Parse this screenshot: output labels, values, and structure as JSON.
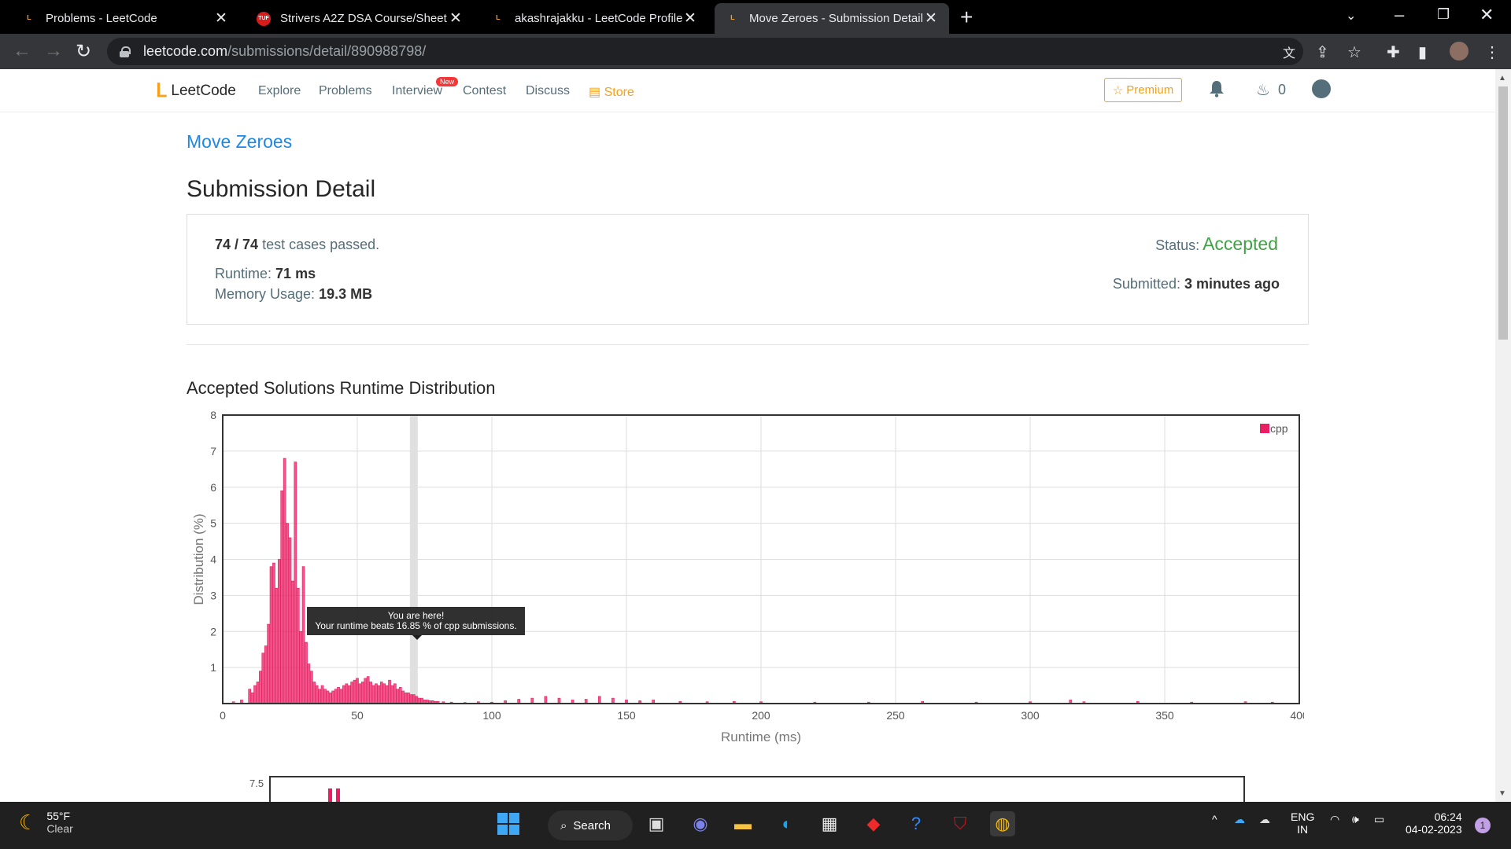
{
  "browser": {
    "tabs": [
      {
        "title": "Problems - LeetCode",
        "favicon": "leetcode-icon",
        "active": false
      },
      {
        "title": "Strivers A2Z DSA Course/Sheet -",
        "favicon": "tuf-icon",
        "active": false
      },
      {
        "title": "akashrajakku - LeetCode Profile",
        "favicon": "leetcode-icon",
        "active": false
      },
      {
        "title": "Move Zeroes - Submission Detail",
        "favicon": "leetcode-icon",
        "active": true
      }
    ],
    "url_host": "leetcode.com",
    "url_path": "/submissions/detail/890988798/"
  },
  "nav": {
    "logo": "LeetCode",
    "links": [
      "Explore",
      "Problems",
      "Interview",
      "Contest",
      "Discuss"
    ],
    "new_badge": "New",
    "store": "Store",
    "premium": "Premium",
    "streak_count": "0"
  },
  "submission": {
    "problem_title": "Move Zeroes",
    "heading": "Submission Detail",
    "testcases_passed": "74 / 74",
    "testcases_suffix": "test cases passed.",
    "runtime_label": "Runtime:",
    "runtime_value": "71 ms",
    "memory_label": "Memory Usage:",
    "memory_value": "19.3 MB",
    "status_label": "Status:",
    "status_value": "Accepted",
    "submitted_label": "Submitted:",
    "submitted_value": "3 minutes ago"
  },
  "chart_section_title": "Accepted Solutions Runtime Distribution",
  "tooltip": {
    "line1": "You are here!",
    "line2": "Your runtime beats 16.85 % of cpp submissions."
  },
  "chart_data": {
    "type": "bar",
    "xlabel": "Runtime (ms)",
    "ylabel": "Distribution (%)",
    "xlim": [
      0,
      400
    ],
    "ylim": [
      0,
      8
    ],
    "xticks": [
      0,
      50,
      100,
      150,
      200,
      250,
      300,
      350,
      400
    ],
    "yticks": [
      1,
      2,
      3,
      4,
      5,
      6,
      7,
      8
    ],
    "legend": "top-right",
    "grid": true,
    "highlight_x": 71,
    "series": [
      {
        "name": "cpp",
        "color": "#e91e63",
        "x": [
          4,
          7,
          10,
          11,
          12,
          13,
          14,
          15,
          16,
          17,
          18,
          19,
          20,
          21,
          22,
          23,
          24,
          25,
          26,
          27,
          28,
          29,
          30,
          31,
          32,
          33,
          34,
          35,
          36,
          37,
          38,
          39,
          40,
          41,
          42,
          43,
          44,
          45,
          46,
          47,
          48,
          49,
          50,
          51,
          52,
          53,
          54,
          55,
          56,
          57,
          58,
          59,
          60,
          61,
          62,
          63,
          64,
          65,
          66,
          67,
          68,
          69,
          70,
          71,
          72,
          73,
          74,
          75,
          76,
          77,
          78,
          79,
          80,
          82,
          85,
          90,
          95,
          100,
          105,
          110,
          115,
          120,
          125,
          130,
          135,
          140,
          145,
          150,
          155,
          160,
          170,
          180,
          190,
          200,
          220,
          240,
          260,
          280,
          300,
          315,
          320,
          340,
          360,
          380,
          390
        ],
        "values": [
          0.05,
          0.1,
          0.4,
          0.3,
          0.5,
          0.6,
          0.9,
          1.4,
          1.6,
          2.2,
          3.8,
          3.9,
          3.2,
          4.0,
          5.9,
          6.8,
          5.0,
          4.6,
          3.4,
          6.7,
          3.2,
          2.0,
          3.8,
          1.7,
          1.1,
          0.9,
          0.6,
          0.5,
          0.4,
          0.5,
          0.4,
          0.35,
          0.3,
          0.35,
          0.4,
          0.45,
          0.4,
          0.5,
          0.55,
          0.5,
          0.6,
          0.65,
          0.7,
          0.55,
          0.6,
          0.7,
          0.75,
          0.6,
          0.5,
          0.55,
          0.5,
          0.6,
          0.55,
          0.5,
          0.65,
          0.5,
          0.55,
          0.4,
          0.45,
          0.35,
          0.3,
          0.3,
          0.25,
          0.25,
          0.2,
          0.15,
          0.15,
          0.1,
          0.1,
          0.08,
          0.08,
          0.06,
          0.06,
          0.05,
          0.04,
          0.03,
          0.05,
          0.04,
          0.08,
          0.12,
          0.15,
          0.2,
          0.15,
          0.1,
          0.12,
          0.2,
          0.15,
          0.1,
          0.08,
          0.1,
          0.06,
          0.05,
          0.06,
          0.05,
          0.04,
          0.04,
          0.06,
          0.04,
          0.05,
          0.1,
          0.05,
          0.06,
          0.04,
          0.05,
          0.04
        ]
      }
    ]
  },
  "chart2_visible_tick": "7.5",
  "taskbar": {
    "temperature": "55°F",
    "condition": "Clear",
    "search": "Search",
    "lang": "ENG",
    "region": "IN",
    "time": "06:24",
    "date": "04-02-2023",
    "notification_count": "1"
  }
}
